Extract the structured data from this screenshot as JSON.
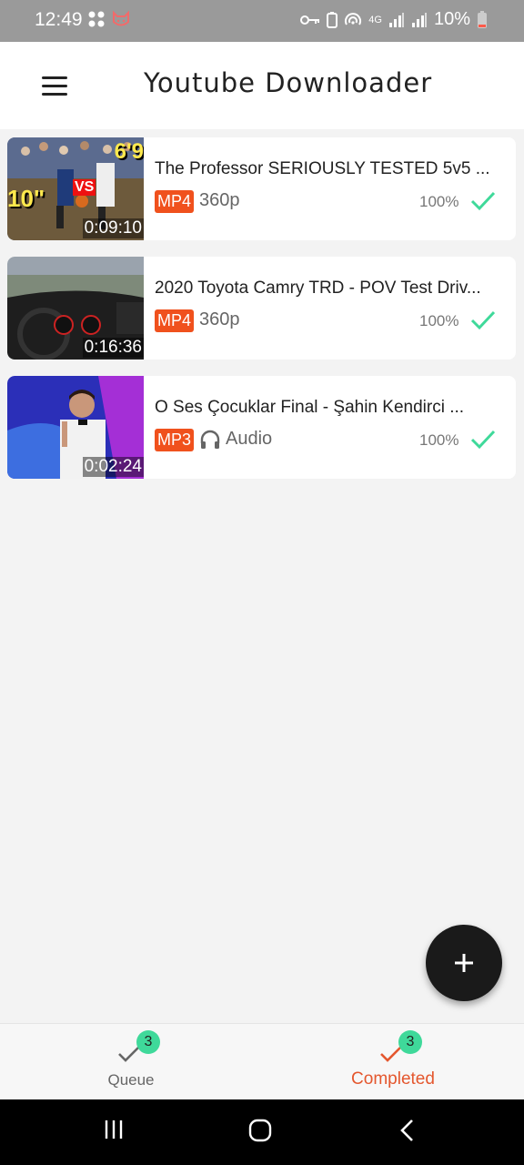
{
  "status_bar": {
    "time": "12:49",
    "battery": "10%",
    "network_label": "4G"
  },
  "app": {
    "title": "Youtube Downloader"
  },
  "downloads": [
    {
      "title": "The Professor SERIOUSLY TESTED 5v5 ...",
      "duration": "0:09:10",
      "format": "MP4",
      "quality": "360p",
      "progress_text": "100%",
      "thumbnail_text": {
        "left": "10\"",
        "right": "6'9",
        "vs": "VS"
      }
    },
    {
      "title": "2020 Toyota Camry TRD - POV Test Driv...",
      "duration": "0:16:36",
      "format": "MP4",
      "quality": "360p",
      "progress_text": "100%"
    },
    {
      "title": "O Ses Çocuklar Final - Şahin Kendirci ...",
      "duration": "0:02:24",
      "format": "MP3",
      "quality": "Audio",
      "progress_text": "100%"
    }
  ],
  "bottom_nav": {
    "queue": {
      "label": "Queue",
      "count": "3"
    },
    "completed": {
      "label": "Completed",
      "count": "3"
    }
  },
  "colors": {
    "accent": "#e4572e",
    "badge": "#f0511d",
    "success": "#3fd99a",
    "fab": "#1a1a1a"
  }
}
